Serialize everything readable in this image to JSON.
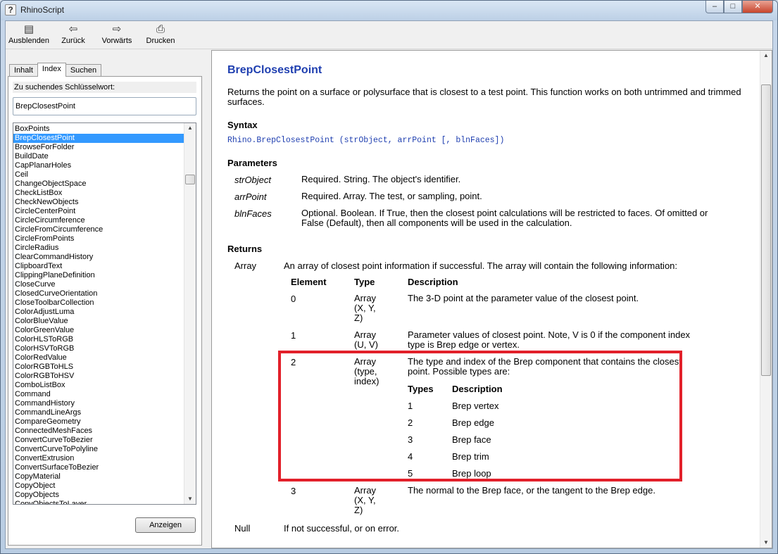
{
  "window": {
    "title": "RhinoScript",
    "controls": {
      "minimize": "–",
      "maximize": "□",
      "close": "✕"
    }
  },
  "toolbar": {
    "buttons": [
      {
        "label": "Ausblenden",
        "icon": "hide-pane-icon"
      },
      {
        "label": "Zurück",
        "icon": "arrow-left-icon"
      },
      {
        "label": "Vorwärts",
        "icon": "arrow-right-icon"
      },
      {
        "label": "Drucken",
        "icon": "printer-icon"
      }
    ]
  },
  "left": {
    "tabs": [
      "Inhalt",
      "Index",
      "Suchen"
    ],
    "active_tab": "Index",
    "keyword_label": "Zu suchendes Schlüsselwort:",
    "keyword_value": "BrepClosestPoint",
    "selected_item": "BrepClosestPoint",
    "items": [
      "BoxPoints",
      "BrepClosestPoint",
      "BrowseForFolder",
      "BuildDate",
      "CapPlanarHoles",
      "Ceil",
      "ChangeObjectSpace",
      "CheckListBox",
      "CheckNewObjects",
      "CircleCenterPoint",
      "CircleCircumference",
      "CircleFromCircumference",
      "CircleFromPoints",
      "CircleRadius",
      "ClearCommandHistory",
      "ClipboardText",
      "ClippingPlaneDefinition",
      "CloseCurve",
      "ClosedCurveOrientation",
      "CloseToolbarCollection",
      "ColorAdjustLuma",
      "ColorBlueValue",
      "ColorGreenValue",
      "ColorHLSToRGB",
      "ColorHSVToRGB",
      "ColorRedValue",
      "ColorRGBToHLS",
      "ColorRGBToHSV",
      "ComboListBox",
      "Command",
      "CommandHistory",
      "CommandLineArgs",
      "CompareGeometry",
      "ConnectedMeshFaces",
      "ConvertCurveToBezier",
      "ConvertCurveToPolyline",
      "ConvertExtrusion",
      "ConvertSurfaceToBezier",
      "CopyMaterial",
      "CopyObject",
      "CopyObjects",
      "CopyObjectsToLayer"
    ],
    "show_button": "Anzeigen"
  },
  "doc": {
    "title": "BrepClosestPoint",
    "description": "Returns the point on a surface or polysurface that is closest to a test point. This function works on both untrimmed and trimmed surfaces.",
    "syntax_heading": "Syntax",
    "syntax": "Rhino.BrepClosestPoint (strObject, arrPoint [, blnFaces])",
    "parameters_heading": "Parameters",
    "parameters": [
      {
        "name": "strObject",
        "desc": "Required. String. The object's identifier."
      },
      {
        "name": "arrPoint",
        "desc": "Required.  Array.  The test, or sampling, point."
      },
      {
        "name": "blnFaces",
        "desc": "Optional.  Boolean.  If True, then the closest point calculations will be restricted to faces. Of omitted or False (Default), then all components will be used in the calculation."
      }
    ],
    "returns_heading": "Returns",
    "returns_type": "Array",
    "returns_desc": "An array of closest point information if successful.  The array will contain the following information:",
    "table_headers": {
      "element": "Element",
      "type": "Type",
      "description": "Description"
    },
    "rows": [
      {
        "element": "0",
        "type": "Array\n(X, Y,\nZ)",
        "desc": "The 3-D point at the parameter value of the closest point."
      },
      {
        "element": "1",
        "type": "Array\n(U, V)",
        "desc": "Parameter values of closest point.  Note, V is 0 if the component index type is Brep edge or vertex."
      },
      {
        "element": "2",
        "type": "Array\n(type,\nindex)",
        "desc": "The type and index of the Brep component that contains the closest point. Possible types are:"
      },
      {
        "element": "3",
        "type": "Array\n(X, Y,\nZ)",
        "desc": "The normal to the Brep face, or the tangent to the Brep edge."
      }
    ],
    "sub_headers": {
      "types": "Types",
      "description": "Description"
    },
    "sub_rows": [
      {
        "type": "1",
        "desc": "Brep vertex"
      },
      {
        "type": "2",
        "desc": "Brep edge"
      },
      {
        "type": "3",
        "desc": "Brep face"
      },
      {
        "type": "4",
        "desc": "Brep trim"
      },
      {
        "type": "5",
        "desc": "Brep loop"
      }
    ],
    "null_type": "Null",
    "null_desc": "If not successful, or on error."
  },
  "colors": {
    "link_blue": "#1f3fb0",
    "selection": "#3399ff",
    "highlight_box": "#e2202a"
  }
}
